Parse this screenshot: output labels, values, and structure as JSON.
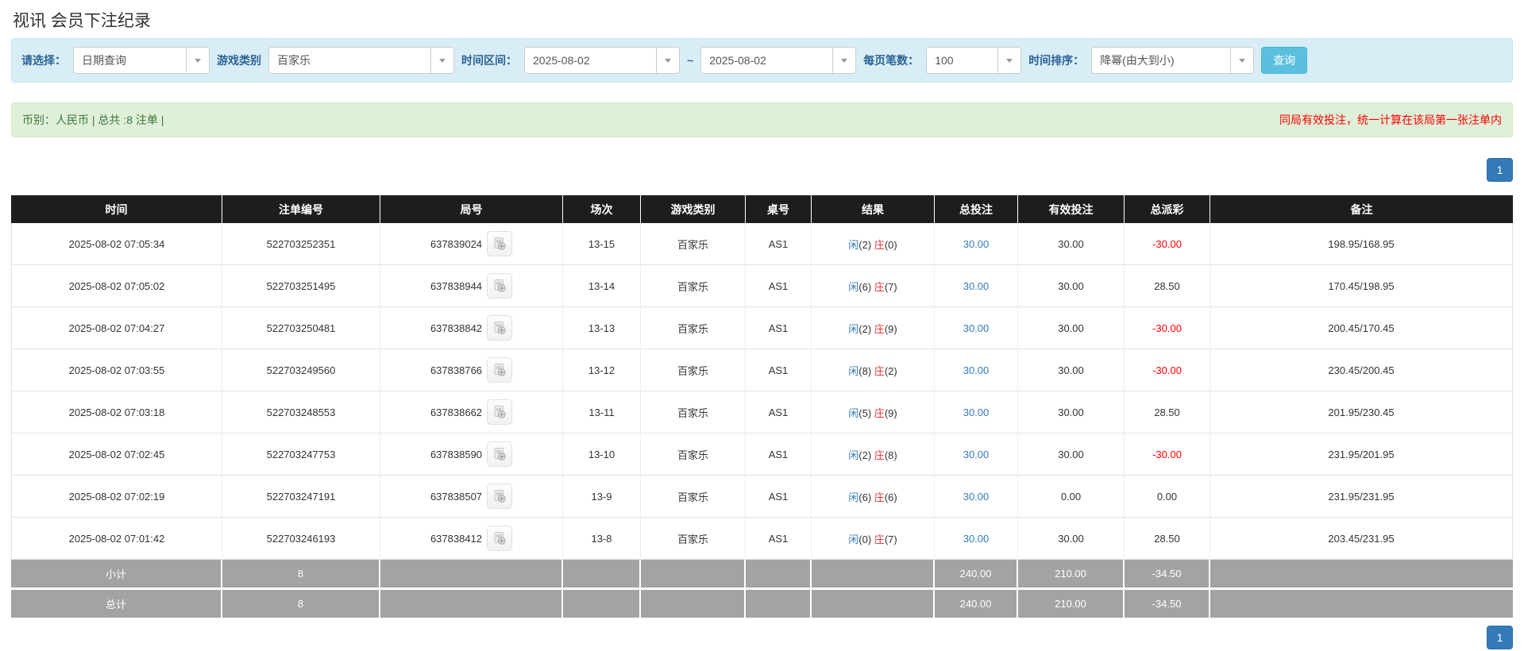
{
  "page": {
    "title": "视讯 会员下注纪录"
  },
  "filters": {
    "query_type_label": "请选择：",
    "query_type_value": "日期查询",
    "game_category_label": "游戏类别",
    "game_category_value": "百家乐",
    "time_range_label": "时间区间：",
    "time_from": "2025-08-02",
    "range_separator": "~",
    "time_to": "2025-08-02",
    "page_size_label": "每页笔数：",
    "page_size_value": "100",
    "sort_label": "时间排序：",
    "sort_value": "降幂(由大到小)",
    "search_button_label": "查询"
  },
  "summary": {
    "left_text": "币别：人民币 | 总共 :8 注单 |",
    "right_notice": "同局有效投注，统一计算在该局第一张注单内"
  },
  "pagination": {
    "current_page": "1"
  },
  "colors": {
    "filter_bar_bg": "#d9edf7",
    "label_blue": "#2a6496",
    "search_button_bg": "#5bc0de",
    "summary_bg": "#dff0d8",
    "summary_text_green": "#3c763d",
    "notice_red": "#ff0000",
    "table_header_bg": "#1d1d1d",
    "link_blue": "#337ab7",
    "banker_red": "#e4393c",
    "negative_red": "#ff0000",
    "footer_bg": "#a3a3a3",
    "page_button_bg": "#337ab7"
  },
  "icons": {
    "dropdown_arrow": "caret-down-icon",
    "round_video": "video-replay-icon"
  },
  "table": {
    "headers": [
      "时间",
      "注单编号",
      "局号",
      "场次",
      "游戏类别",
      "桌号",
      "结果",
      "总投注",
      "有效投注",
      "总派彩",
      "备注"
    ],
    "rows": [
      {
        "time": "2025-08-02 07:05:34",
        "bet_no": "522703252351",
        "round_no": "637839024",
        "session": "13-15",
        "game": "百家乐",
        "table_no": "AS1",
        "result": {
          "player_label": "闲",
          "player_value": "(2)",
          "banker_label": "庄",
          "banker_value": "(0)"
        },
        "total_bet": "30.00",
        "valid_bet": "30.00",
        "payout": "-30.00",
        "payout_negative": true,
        "remark": "198.95/168.95"
      },
      {
        "time": "2025-08-02 07:05:02",
        "bet_no": "522703251495",
        "round_no": "637838944",
        "session": "13-14",
        "game": "百家乐",
        "table_no": "AS1",
        "result": {
          "player_label": "闲",
          "player_value": "(6)",
          "banker_label": "庄",
          "banker_value": "(7)"
        },
        "total_bet": "30.00",
        "valid_bet": "30.00",
        "payout": "28.50",
        "payout_negative": false,
        "remark": "170.45/198.95"
      },
      {
        "time": "2025-08-02 07:04:27",
        "bet_no": "522703250481",
        "round_no": "637838842",
        "session": "13-13",
        "game": "百家乐",
        "table_no": "AS1",
        "result": {
          "player_label": "闲",
          "player_value": "(2)",
          "banker_label": "庄",
          "banker_value": "(9)"
        },
        "total_bet": "30.00",
        "valid_bet": "30.00",
        "payout": "-30.00",
        "payout_negative": true,
        "remark": "200.45/170.45"
      },
      {
        "time": "2025-08-02 07:03:55",
        "bet_no": "522703249560",
        "round_no": "637838766",
        "session": "13-12",
        "game": "百家乐",
        "table_no": "AS1",
        "result": {
          "player_label": "闲",
          "player_value": "(8)",
          "banker_label": "庄",
          "banker_value": "(2)"
        },
        "total_bet": "30.00",
        "valid_bet": "30.00",
        "payout": "-30.00",
        "payout_negative": true,
        "remark": "230.45/200.45"
      },
      {
        "time": "2025-08-02 07:03:18",
        "bet_no": "522703248553",
        "round_no": "637838662",
        "session": "13-11",
        "game": "百家乐",
        "table_no": "AS1",
        "result": {
          "player_label": "闲",
          "player_value": "(5)",
          "banker_label": "庄",
          "banker_value": "(9)"
        },
        "total_bet": "30.00",
        "valid_bet": "30.00",
        "payout": "28.50",
        "payout_negative": false,
        "remark": "201.95/230.45"
      },
      {
        "time": "2025-08-02 07:02:45",
        "bet_no": "522703247753",
        "round_no": "637838590",
        "session": "13-10",
        "game": "百家乐",
        "table_no": "AS1",
        "result": {
          "player_label": "闲",
          "player_value": "(2)",
          "banker_label": "庄",
          "banker_value": "(8)"
        },
        "total_bet": "30.00",
        "valid_bet": "30.00",
        "payout": "-30.00",
        "payout_negative": true,
        "remark": "231.95/201.95"
      },
      {
        "time": "2025-08-02 07:02:19",
        "bet_no": "522703247191",
        "round_no": "637838507",
        "session": "13-9",
        "game": "百家乐",
        "table_no": "AS1",
        "result": {
          "player_label": "闲",
          "player_value": "(6)",
          "banker_label": "庄",
          "banker_value": "(6)"
        },
        "total_bet": "30.00",
        "valid_bet": "0.00",
        "payout": "0.00",
        "payout_negative": false,
        "remark": "231.95/231.95"
      },
      {
        "time": "2025-08-02 07:01:42",
        "bet_no": "522703246193",
        "round_no": "637838412",
        "session": "13-8",
        "game": "百家乐",
        "table_no": "AS1",
        "result": {
          "player_label": "闲",
          "player_value": "(0)",
          "banker_label": "庄",
          "banker_value": "(7)"
        },
        "total_bet": "30.00",
        "valid_bet": "30.00",
        "payout": "28.50",
        "payout_negative": false,
        "remark": "203.45/231.95"
      }
    ],
    "footer_rows": [
      {
        "label": "小计",
        "count": "8",
        "total_bet": "240.00",
        "valid_bet": "210.00",
        "payout": "-34.50",
        "payout_negative": true
      },
      {
        "label": "总计",
        "count": "8",
        "total_bet": "240.00",
        "valid_bet": "210.00",
        "payout": "-34.50",
        "payout_negative": true
      }
    ]
  }
}
